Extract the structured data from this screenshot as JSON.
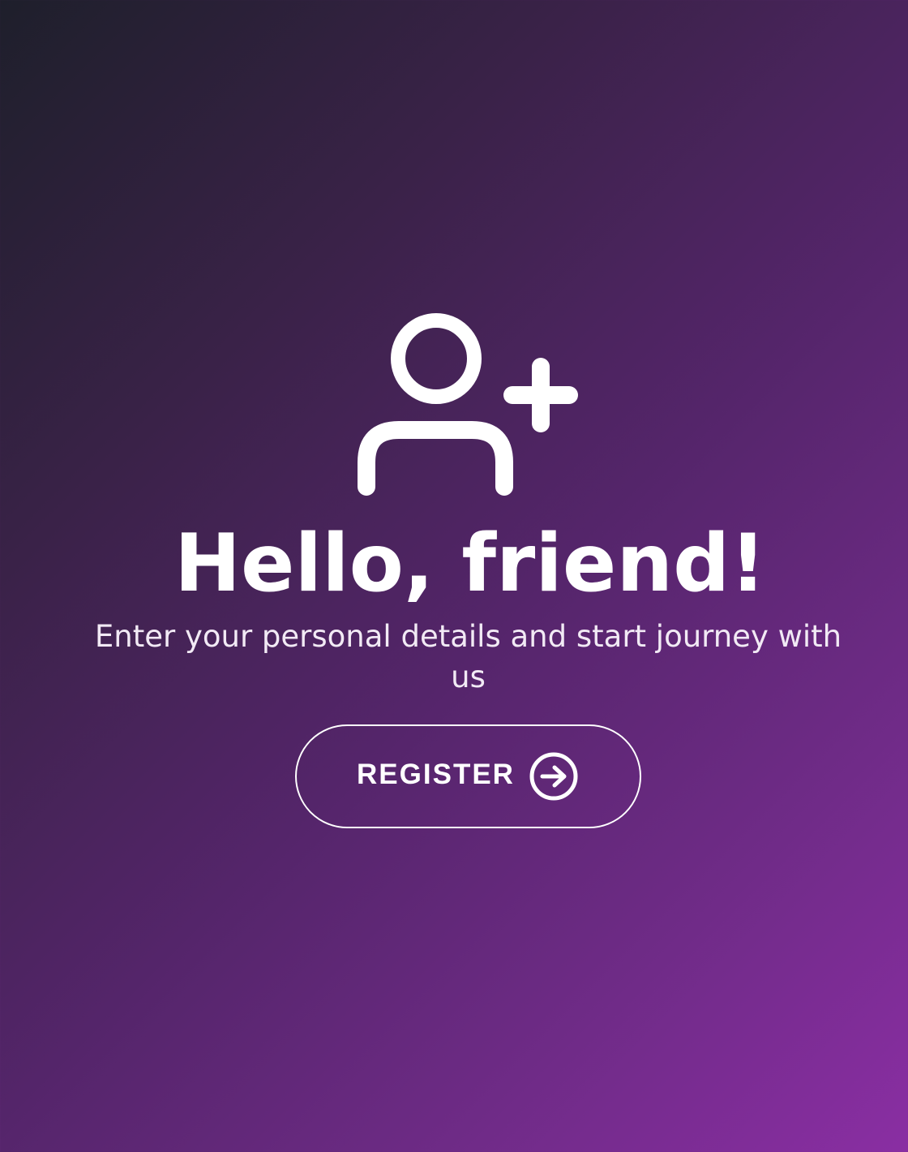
{
  "hero": {
    "icon": "add-user-icon",
    "title": "Hello, friend!",
    "subtitle": "Enter your personal details and start journey with us"
  },
  "actions": {
    "register_label": "REGISTER",
    "register_icon": "arrow-right-circle-icon"
  },
  "colors": {
    "gradient_start": "#1e1f2b",
    "gradient_end": "#8a2ea3",
    "text": "#ffffff"
  }
}
